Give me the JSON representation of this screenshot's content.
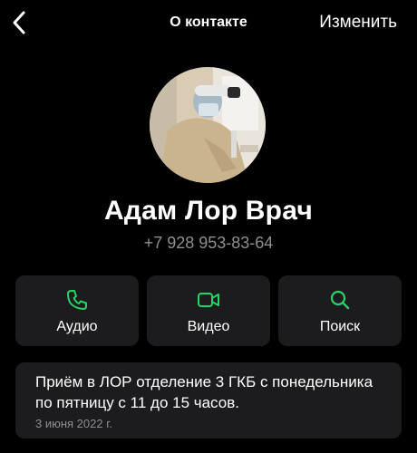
{
  "header": {
    "back_icon": "chevron-left-icon",
    "title": "О контакте",
    "edit_label": "Изменить"
  },
  "contact": {
    "name": "Адам Лор Врач",
    "phone": "+7 928 953-83-64"
  },
  "actions": [
    {
      "label": "Аудио",
      "icon": "phone-icon"
    },
    {
      "label": "Видео",
      "icon": "video-icon"
    },
    {
      "label": "Поиск",
      "icon": "search-icon"
    }
  ],
  "about": {
    "text": "Приём в ЛОР отделение 3 ГКБ с понедельника по пятницу с 11 до 15 часов.",
    "date": "3 июня 2022 г."
  },
  "colors": {
    "background": "#000000",
    "card": "#1c1c1e",
    "accent": "#25d366",
    "secondary_text": "#8e8e93"
  }
}
